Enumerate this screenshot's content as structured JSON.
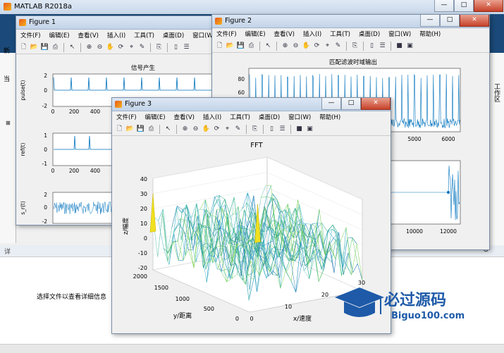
{
  "app": {
    "title": "MATLAB R2018a"
  },
  "panels": {
    "detail_label": "详",
    "detail_message": "选择文件以查看详细信息",
    "right_label": "工作区",
    "left_label": "当",
    "left_label2": "新"
  },
  "menu": [
    "文件(F)",
    "编辑(E)",
    "查看(V)",
    "插入(I)",
    "工具(T)",
    "桌面(D)",
    "窗口(W)",
    "帮助(H)"
  ],
  "figure1": {
    "title": "Figure 1",
    "subplot1": {
      "title": "信号产生",
      "ylabel": "pulse(t)",
      "yticks": [
        "2",
        "0",
        "-2"
      ],
      "xticks": [
        "0",
        "200",
        "400",
        "600"
      ]
    },
    "subplot2": {
      "ylabel": "ref(t)",
      "yticks": [
        "1",
        "0",
        "-1"
      ],
      "xticks": [
        "0",
        "200",
        "400",
        "600"
      ]
    },
    "subplot3": {
      "ylabel": "s_r(t)",
      "yticks": [
        "2",
        "0",
        "-2"
      ],
      "xticks": [
        "0",
        "200",
        "400"
      ]
    }
  },
  "figure2": {
    "title": "Figure 2",
    "subplot1": {
      "title": "匹配滤波时域输出",
      "yticks": [
        "80",
        "60",
        "40",
        "20",
        "0"
      ],
      "xticks": [
        "5000",
        "6000"
      ]
    },
    "subplot2": {
      "xticks": [
        "10000",
        "12000"
      ]
    }
  },
  "figure3": {
    "title": "Figure 3",
    "chart_title": "FFT",
    "zlabel": "z/幅度",
    "ylabel": "y/距离",
    "xlabel": "x/速度",
    "zticks": [
      "40",
      "30",
      "20",
      "10",
      "0",
      "-10",
      "-20"
    ],
    "yticks": [
      "2000",
      "1500",
      "1000",
      "500",
      "0"
    ],
    "xticks": [
      "0",
      "10",
      "20",
      "30"
    ]
  },
  "watermark": {
    "main": "必过源码",
    "sub": "Biguo100.com"
  },
  "chart_data": {
    "type": "surface",
    "title": "FFT",
    "xlabel": "x/速度",
    "ylabel": "y/距离",
    "zlabel": "z/幅度",
    "xlim": [
      0,
      32
    ],
    "ylim": [
      0,
      2000
    ],
    "zlim": [
      -20,
      40
    ],
    "peaks": [
      {
        "x": 0,
        "y": 2000,
        "z": 30
      },
      {
        "x": 16,
        "y": 1000,
        "z": 30
      }
    ],
    "noise_floor_range": [
      -15,
      15
    ]
  },
  "colors": {
    "accent": "#1b4a7a",
    "line": "#0072bd",
    "peak": "#f0e020"
  }
}
